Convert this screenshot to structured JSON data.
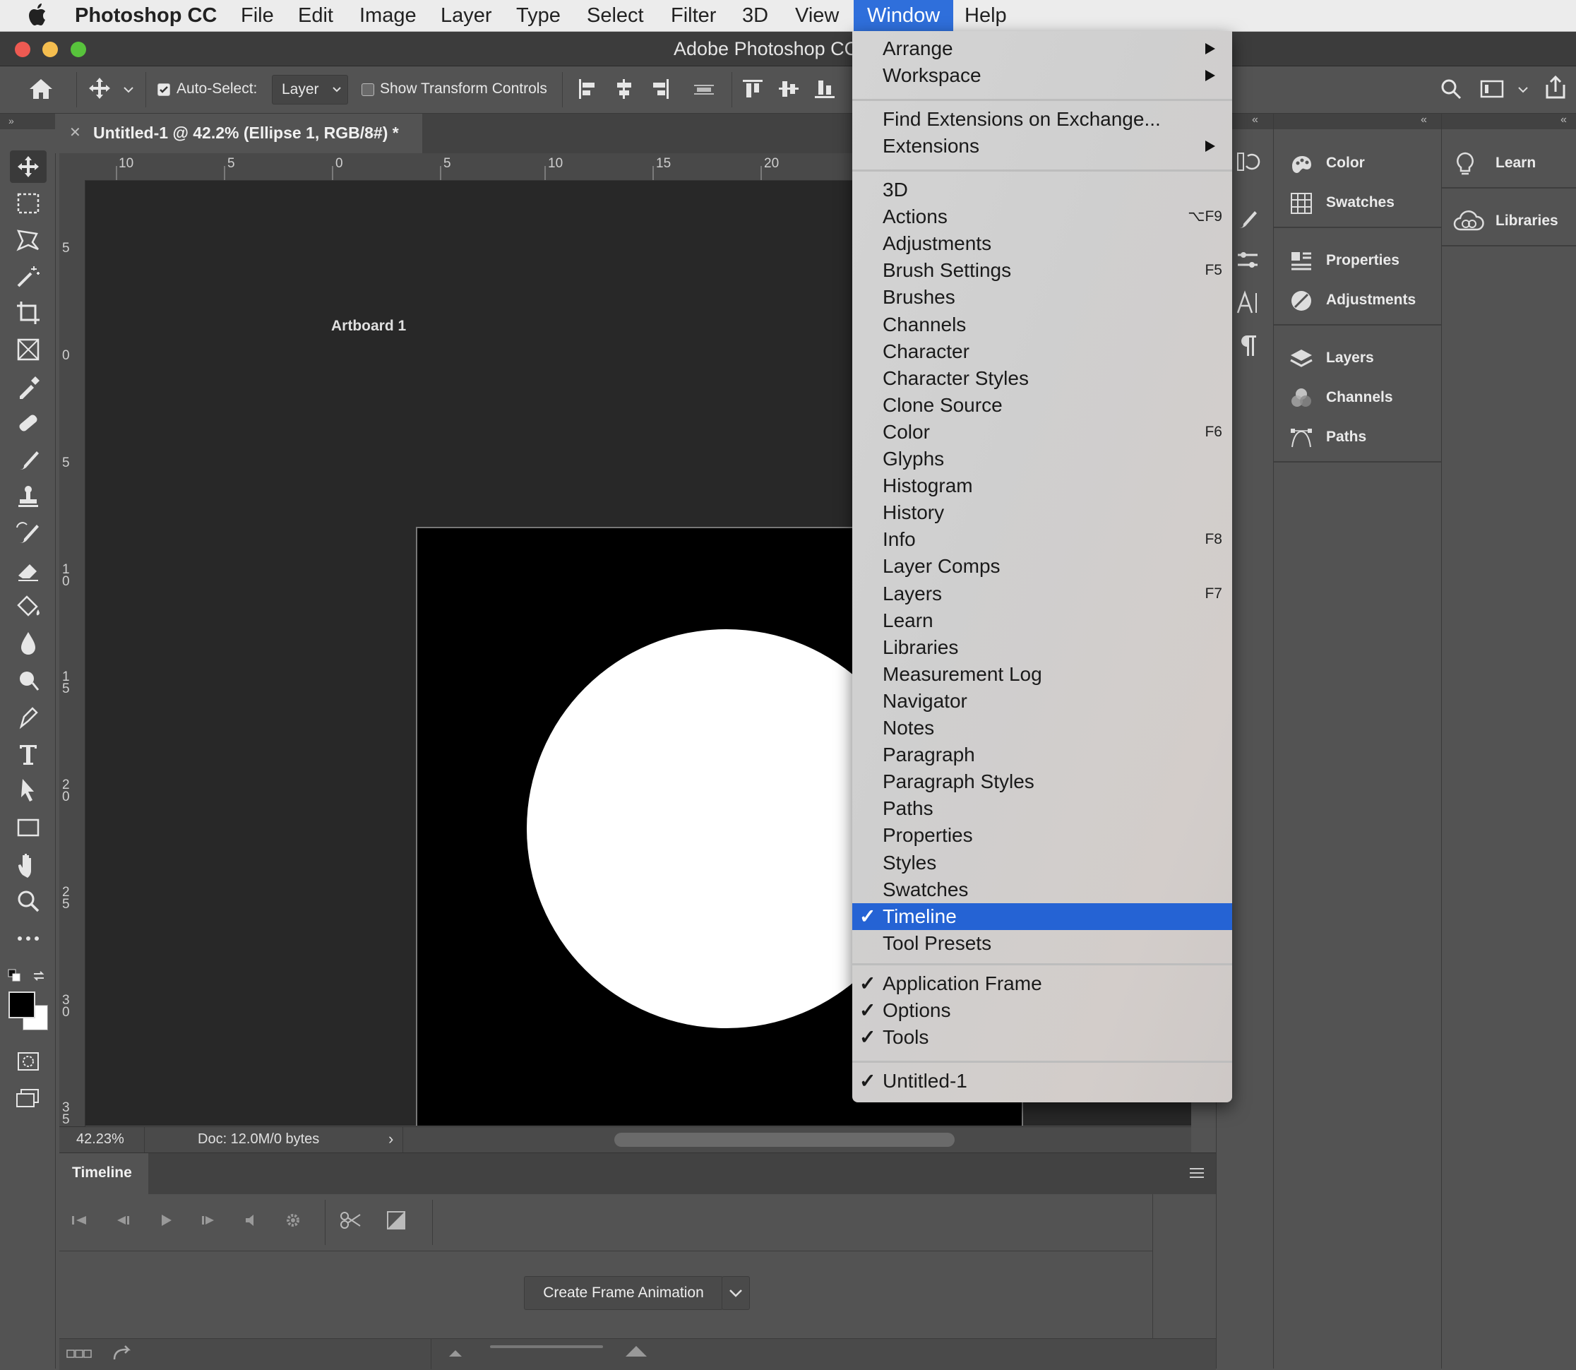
{
  "menubar": {
    "app_name": "Photoshop CC",
    "items": [
      "File",
      "Edit",
      "Image",
      "Layer",
      "Type",
      "Select",
      "Filter",
      "3D",
      "View",
      "Window",
      "Help"
    ],
    "active": "Window"
  },
  "window": {
    "title": "Adobe Photoshop CC"
  },
  "options": {
    "auto_select_label": "Auto-Select:",
    "auto_select_checked": true,
    "auto_select_value": "Layer",
    "show_transform_label": "Show Transform Controls",
    "show_transform_checked": false
  },
  "document": {
    "tab_title": "Untitled-1 @ 42.2% (Ellipse 1, RGB/8#) *",
    "artboard_label": "Artboard 1"
  },
  "ruler": {
    "h_labels": [
      "10",
      "5",
      "0",
      "5",
      "10",
      "15",
      "20"
    ],
    "v_labels": [
      "5",
      "0",
      "5",
      "1\n0",
      "1\n5",
      "2\n0",
      "2\n5",
      "3\n0",
      "3\n5"
    ]
  },
  "status": {
    "zoom": "42.23%",
    "doc": "Doc: 12.0M/0 bytes"
  },
  "timeline": {
    "tab": "Timeline",
    "create_button": "Create Frame Animation"
  },
  "panels": {
    "group1": [
      "Color",
      "Swatches"
    ],
    "group2": [
      "Properties",
      "Adjustments"
    ],
    "group3": [
      "Layers",
      "Channels",
      "Paths"
    ],
    "group4": [
      "Learn"
    ],
    "group5": [
      "Libraries"
    ]
  },
  "window_menu": {
    "section1": [
      {
        "label": "Arrange",
        "submenu": true
      },
      {
        "label": "Workspace",
        "submenu": true
      }
    ],
    "section2": [
      {
        "label": "Find Extensions on Exchange..."
      },
      {
        "label": "Extensions",
        "submenu": true
      }
    ],
    "section3": [
      {
        "label": "3D",
        "shortcut": ""
      },
      {
        "label": "Actions",
        "shortcut": "⌥F9"
      },
      {
        "label": "Adjustments",
        "shortcut": ""
      },
      {
        "label": "Brush Settings",
        "shortcut": "F5"
      },
      {
        "label": "Brushes",
        "shortcut": ""
      },
      {
        "label": "Channels",
        "shortcut": ""
      },
      {
        "label": "Character",
        "shortcut": ""
      },
      {
        "label": "Character Styles",
        "shortcut": ""
      },
      {
        "label": "Clone Source",
        "shortcut": ""
      },
      {
        "label": "Color",
        "shortcut": "F6"
      },
      {
        "label": "Glyphs",
        "shortcut": ""
      },
      {
        "label": "Histogram",
        "shortcut": ""
      },
      {
        "label": "History",
        "shortcut": ""
      },
      {
        "label": "Info",
        "shortcut": "F8"
      },
      {
        "label": "Layer Comps",
        "shortcut": ""
      },
      {
        "label": "Layers",
        "shortcut": "F7"
      },
      {
        "label": "Learn",
        "shortcut": ""
      },
      {
        "label": "Libraries",
        "shortcut": ""
      },
      {
        "label": "Measurement Log",
        "shortcut": ""
      },
      {
        "label": "Navigator",
        "shortcut": ""
      },
      {
        "label": "Notes",
        "shortcut": ""
      },
      {
        "label": "Paragraph",
        "shortcut": ""
      },
      {
        "label": "Paragraph Styles",
        "shortcut": ""
      },
      {
        "label": "Paths",
        "shortcut": ""
      },
      {
        "label": "Properties",
        "shortcut": ""
      },
      {
        "label": "Styles",
        "shortcut": ""
      },
      {
        "label": "Swatches",
        "shortcut": ""
      },
      {
        "label": "Timeline",
        "shortcut": "",
        "checked": true,
        "highlighted": true
      },
      {
        "label": "Tool Presets",
        "shortcut": ""
      }
    ],
    "section4": [
      {
        "label": "Application Frame",
        "checked": true
      },
      {
        "label": "Options",
        "checked": true
      },
      {
        "label": "Tools",
        "checked": true
      }
    ],
    "section5": [
      {
        "label": "Untitled-1",
        "checked": true
      }
    ],
    "checkmark": "✓"
  },
  "colors": {
    "accent": "#2563d4",
    "canvas": "#282828",
    "panel": "#535353"
  }
}
